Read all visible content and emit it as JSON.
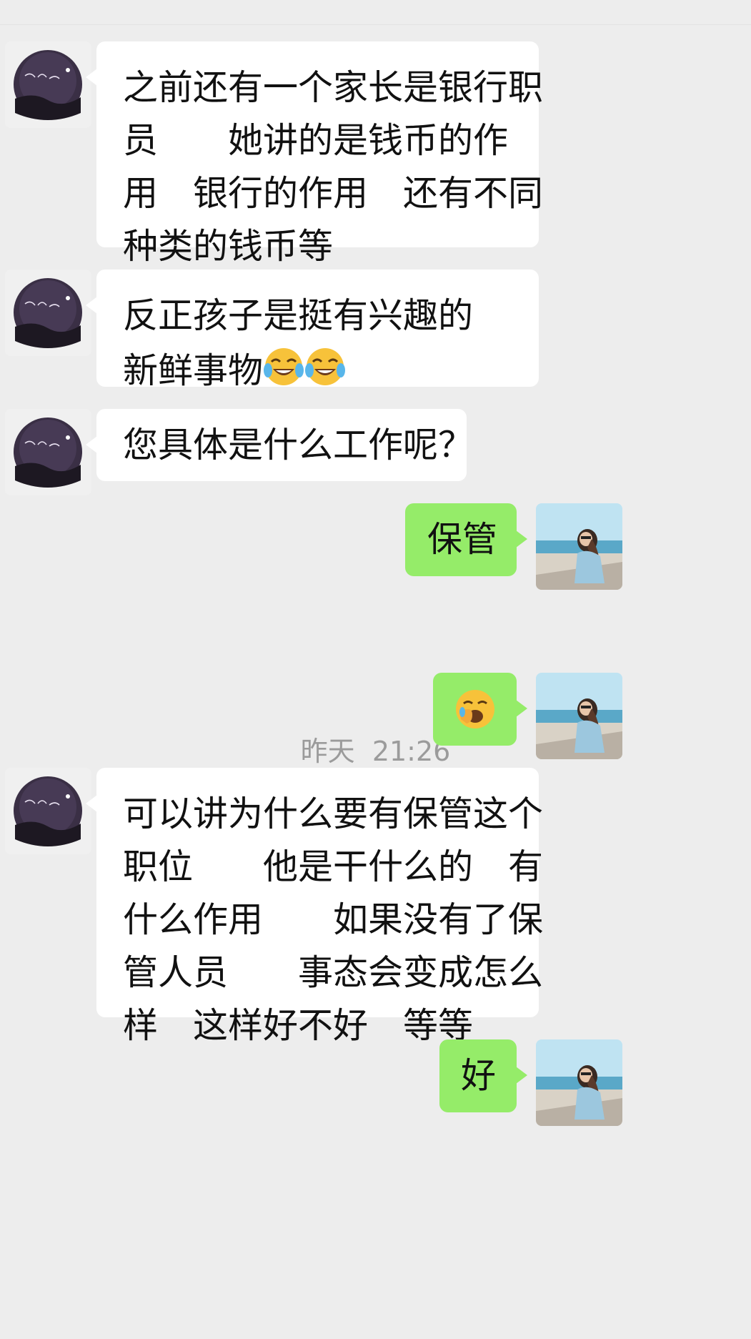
{
  "messages": [
    {
      "side": "in",
      "lines": [
        "之前还有一个家长是银行职",
        "员　　她讲的是钱币的作",
        "用　银行的作用　还有不同",
        "种类的钱币等"
      ]
    },
    {
      "side": "in",
      "lines": [
        "反正孩子是挺有兴趣的",
        "新鲜事物"
      ],
      "trailing_emoji": [
        "tears-of-joy-emoji",
        "tears-of-joy-emoji"
      ]
    },
    {
      "side": "in",
      "lines": [
        "您具体是什么工作呢？"
      ]
    },
    {
      "side": "out",
      "lines": [
        "保管"
      ]
    },
    {
      "side": "out",
      "emoji": "yawning-face-emoji"
    },
    {
      "side": "in",
      "lines": [
        "可以讲为什么要有保管这个",
        "职位　　他是干什么的　有",
        "什么作用　　如果没有了保",
        "管人员　　事态会变成怎么",
        "样　这样好不好　等等"
      ]
    },
    {
      "side": "out",
      "lines": [
        "好"
      ]
    }
  ],
  "timestamp": "昨天  21:26",
  "colors": {
    "background": "#ededed",
    "incoming_bubble": "#ffffff",
    "outgoing_bubble": "#95ec69",
    "timestamp_text": "#9b9b9b"
  }
}
